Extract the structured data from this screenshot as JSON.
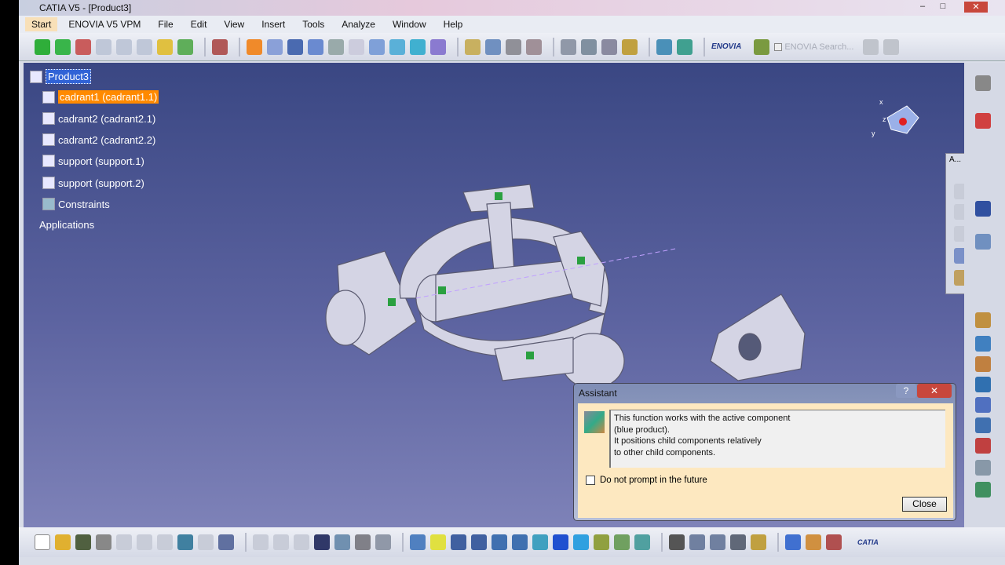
{
  "window": {
    "title": "CATIA V5 - [Product3]",
    "minimize": "–",
    "maximize": "□",
    "close": "✕"
  },
  "menu": [
    "Start",
    "ENOVIA V5 VPM",
    "File",
    "Edit",
    "View",
    "Insert",
    "Tools",
    "Analyze",
    "Window",
    "Help"
  ],
  "enovia": {
    "logo": "ENOVIA",
    "search_placeholder": "ENOVIA Search..."
  },
  "tree": {
    "root": "Product3",
    "items": [
      "cadrant1 (cadrant1.1)",
      "cadrant2 (cadrant2.1)",
      "cadrant2 (cadrant2.2)",
      "support (support.1)",
      "support (support.2)",
      "Constraints",
      "Applications"
    ]
  },
  "mini_toolbar": {
    "title": "A..."
  },
  "compass": {
    "x": "x",
    "y": "y",
    "z": "z"
  },
  "dialog": {
    "title": "Assistant",
    "help": "?",
    "close_x": "✕",
    "message": [
      "This function works with the active component",
      "(blue product).",
      "It positions child components relatively",
      "to other child components."
    ],
    "checkbox_label": "Do not prompt in the future",
    "checkbox_checked": false,
    "close_button": "Close"
  },
  "catia_logo": "CATIA"
}
